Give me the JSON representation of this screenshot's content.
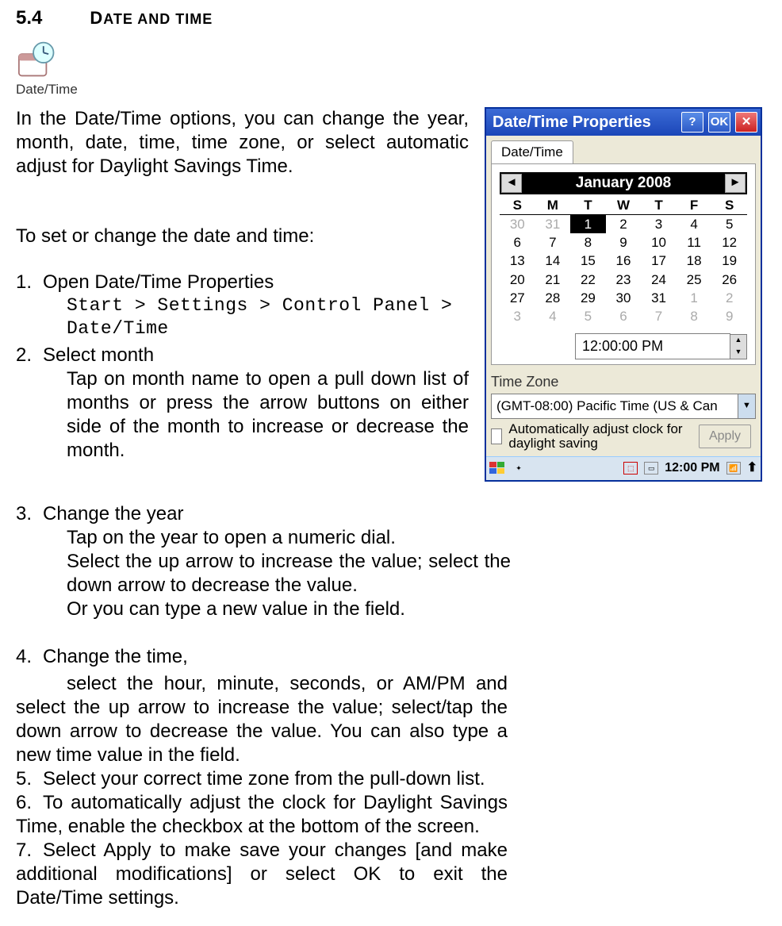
{
  "section": {
    "number": "5.4",
    "title_small": "D",
    "title_rest": "ATE AND TIME",
    "icon_label": "Date/Time"
  },
  "para1": "In the Date/Time options, you can change the year, month, date, time, time zone, or select automatic adjust for Daylight Savings Time.",
  "para2": "To set or change the date and time:",
  "steps": {
    "s1": {
      "num": "1.",
      "title": "Open Date/Time Properties",
      "code1": "Start > Settings > Control Panel >",
      "code2": "Date/Time"
    },
    "s2": {
      "num": "2.",
      "title": "Select month",
      "body": "Tap on month name to open a pull down list of months or press the arrow buttons on either side of the month to increase or decrease the month."
    },
    "s3": {
      "num": "3.",
      "title": "Change the year",
      "b1": "Tap on the year to open a numeric dial.",
      "b2": "Select the up arrow to increase the value; select the down arrow to decrease the value.",
      "b3": "Or you can type a new value in the field."
    },
    "s4": {
      "num": "4.",
      "title": "Change the time,",
      "b1": "select the hour, minute, seconds, or AM/PM and select the up arrow to increase the value; select/tap the down arrow to decrease the value. You can also type a new time value in the field."
    },
    "s5": {
      "num": "5.",
      "title": "Select your correct time zone from the pull-down list."
    },
    "s6": {
      "num": "6.",
      "title": "To automatically adjust the clock for Daylight Savings Time, enable the checkbox at the bottom of the screen."
    },
    "s7": {
      "num": "7.",
      "title": "Select Apply to make save your changes [and make additional modifications] or select OK to exit the Date/Time settings."
    }
  },
  "dialog": {
    "title": "Date/Time Properties",
    "help": "?",
    "ok": "OK",
    "close": "✕",
    "tab": "Date/Time",
    "month": "January 2008",
    "dow": [
      "S",
      "M",
      "T",
      "W",
      "T",
      "F",
      "S"
    ],
    "grid": [
      [
        {
          "v": "30",
          "pm": true
        },
        {
          "v": "31",
          "pm": true
        },
        {
          "v": "1",
          "sel": true
        },
        {
          "v": "2"
        },
        {
          "v": "3"
        },
        {
          "v": "4"
        },
        {
          "v": "5"
        }
      ],
      [
        {
          "v": "6"
        },
        {
          "v": "7"
        },
        {
          "v": "8"
        },
        {
          "v": "9"
        },
        {
          "v": "10"
        },
        {
          "v": "11"
        },
        {
          "v": "12"
        }
      ],
      [
        {
          "v": "13"
        },
        {
          "v": "14"
        },
        {
          "v": "15"
        },
        {
          "v": "16"
        },
        {
          "v": "17"
        },
        {
          "v": "18"
        },
        {
          "v": "19"
        }
      ],
      [
        {
          "v": "20"
        },
        {
          "v": "21"
        },
        {
          "v": "22"
        },
        {
          "v": "23"
        },
        {
          "v": "24"
        },
        {
          "v": "25"
        },
        {
          "v": "26"
        }
      ],
      [
        {
          "v": "27"
        },
        {
          "v": "28"
        },
        {
          "v": "29"
        },
        {
          "v": "30"
        },
        {
          "v": "31"
        },
        {
          "v": "1",
          "pm": true
        },
        {
          "v": "2",
          "pm": true
        }
      ],
      [
        {
          "v": "3",
          "pm": true
        },
        {
          "v": "4",
          "pm": true
        },
        {
          "v": "5",
          "pm": true
        },
        {
          "v": "6",
          "pm": true
        },
        {
          "v": "7",
          "pm": true
        },
        {
          "v": "8",
          "pm": true
        },
        {
          "v": "9",
          "pm": true
        }
      ]
    ],
    "time": "12:00:00 PM",
    "tz_label": "Time Zone",
    "tz_value": "(GMT-08:00) Pacific Time (US & Can",
    "chk_label": "Automatically adjust clock for daylight saving",
    "apply": "Apply",
    "task_time": "12:00 PM"
  }
}
